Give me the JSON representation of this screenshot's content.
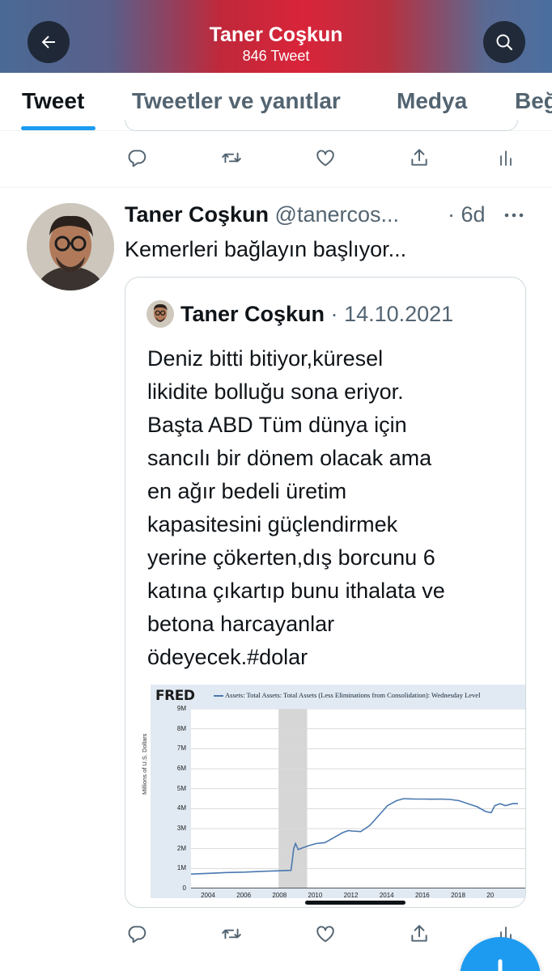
{
  "header": {
    "title": "Taner Coşkun",
    "subtitle": "846 Tweet"
  },
  "tabs": [
    {
      "label": "Tweet",
      "active": true
    },
    {
      "label": "Tweetler ve yanıtlar",
      "active": false
    },
    {
      "label": "Medya",
      "active": false
    },
    {
      "label": "Beğ",
      "active": false
    }
  ],
  "tweet": {
    "name": "Taner Coşkun",
    "handle": "@tanercos...",
    "time": "· 6d",
    "text": "Kemerleri bağlayın başlıyor...",
    "quote": {
      "name": "Taner Coşkun",
      "separator": "·",
      "date": "14.10.2021",
      "lines": [
        "Deniz bitti bitiyor,küresel",
        "likidite bolluğu sona eriyor.",
        "Başta ABD Tüm dünya için",
        "sancılı bir dönem olacak ama",
        "en ağır bedeli üretim",
        "kapasitesini güçlendirmek",
        "yerine çökerten,dış borcunu 6",
        "katına çıkartıp bunu ithalata ve",
        "betona harcayanlar",
        "ödeyecek.#dolar"
      ]
    }
  },
  "colors": {
    "accent": "#1d9bf0",
    "text_primary": "#0f1419",
    "text_secondary": "#536471",
    "border": "#cfd9de",
    "fred_line": "#4a78b0",
    "recession_shade": "#d6d6d6"
  },
  "icons": [
    "back-arrow-icon",
    "search-icon",
    "reply-icon",
    "retweet-icon",
    "like-icon",
    "share-icon",
    "analytics-icon",
    "more-icon"
  ],
  "chart_data": {
    "type": "line",
    "brand": "FRED",
    "title": "Assets: Total Assets: Total Assets (Less Eliminations from Consolidation): Wednesday Level",
    "ylabel": "Millions of U.S. Dollars",
    "xlabel": "",
    "yticks": [
      "0",
      "1M",
      "2M",
      "3M",
      "4M",
      "5M",
      "6M",
      "7M",
      "8M",
      "9M"
    ],
    "xticks": [
      "2004",
      "2006",
      "2008",
      "2010",
      "2012",
      "2014",
      "2016",
      "2018",
      "20"
    ],
    "ylim": [
      0,
      9000000
    ],
    "xlim": [
      2003,
      2021.8
    ],
    "grid": true,
    "recession_shading": [
      [
        2007.9,
        2009.5
      ]
    ],
    "series": [
      {
        "x": [
          2003.0,
          2004.0,
          2005.0,
          2006.0,
          2007.0,
          2007.7,
          2008.6,
          2008.75,
          2008.85,
          2009.0,
          2009.3,
          2009.6,
          2010.0,
          2010.5,
          2011.0,
          2011.5,
          2011.8,
          2012.0,
          2012.5,
          2013.0,
          2013.5,
          2014.0,
          2014.5,
          2014.9,
          2015.5,
          2016.0,
          2016.5,
          2017.0,
          2017.5,
          2018.0,
          2018.5,
          2019.0,
          2019.5,
          2019.8,
          2020.0,
          2020.3,
          2020.6,
          2021.0,
          2021.3
        ],
        "y": [
          720000,
          760000,
          800000,
          820000,
          860000,
          880000,
          910000,
          2000000,
          2250000,
          1950000,
          2050000,
          2150000,
          2250000,
          2300000,
          2550000,
          2800000,
          2900000,
          2880000,
          2850000,
          3150000,
          3650000,
          4150000,
          4400000,
          4500000,
          4480000,
          4480000,
          4470000,
          4480000,
          4460000,
          4400000,
          4250000,
          4100000,
          3850000,
          3800000,
          4150000,
          4250000,
          4150000,
          4250000,
          4250000
        ]
      }
    ]
  }
}
